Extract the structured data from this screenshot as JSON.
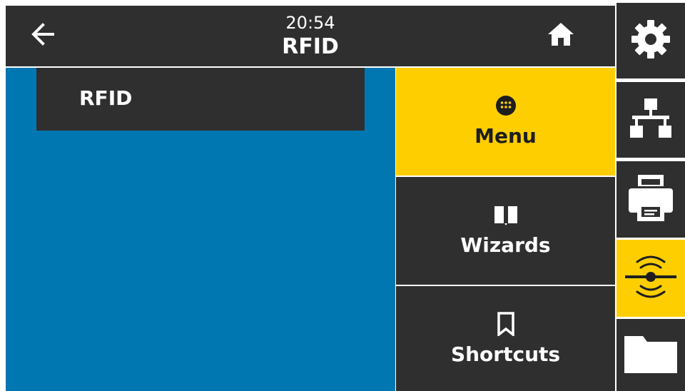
{
  "header": {
    "time": "20:54",
    "title": "RFID",
    "back_icon": "arrow-left-icon",
    "home_icon": "home-icon"
  },
  "content": {
    "menu_items": [
      {
        "label": "RFID"
      }
    ]
  },
  "nav": {
    "tiles": [
      {
        "label": "Menu",
        "icon": "grid-dots-icon",
        "active": true
      },
      {
        "label": "Wizards",
        "icon": "book-icon",
        "active": false
      },
      {
        "label": "Shortcuts",
        "icon": "bookmark-icon",
        "active": false
      }
    ]
  },
  "sidebar": {
    "items": [
      {
        "icon": "gear-icon",
        "active": false
      },
      {
        "icon": "network-icon",
        "active": false
      },
      {
        "icon": "printer-icon",
        "active": false
      },
      {
        "icon": "rfid-icon",
        "active": true
      },
      {
        "icon": "folder-icon",
        "active": false
      }
    ]
  },
  "colors": {
    "header_bg": "#2f2f2f",
    "content_bg": "#0077b0",
    "accent_yellow": "#ffce00",
    "text_light": "#ffffff"
  }
}
